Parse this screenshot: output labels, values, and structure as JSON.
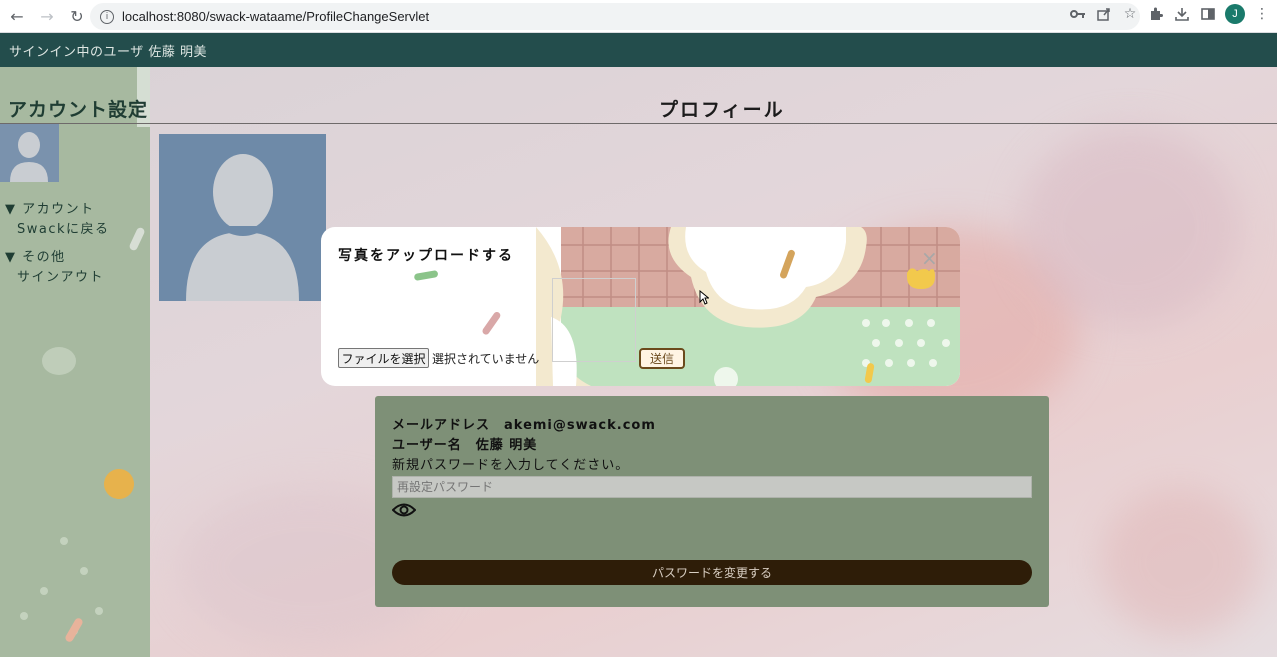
{
  "browser": {
    "url": "localhost:8080/swack-wataame/ProfileChangeServlet",
    "profile_initial": "J"
  },
  "header": {
    "signed_in_text": "サインイン中のユーザ 佐藤 明美"
  },
  "sidebar": {
    "title": "アカウント設定",
    "sections": [
      {
        "heading": "▼ アカウント",
        "items": [
          "Swackに戻る"
        ]
      },
      {
        "heading": "▼ その他",
        "items": [
          "サインアウト"
        ]
      }
    ]
  },
  "main": {
    "title": "プロフィール"
  },
  "profile_card": {
    "email_line": "メールアドレス　akemi@swack.com",
    "username_line": "ユーザー名　佐藤 明美",
    "password_prompt": "新規パスワードを入力してください。",
    "password_placeholder": "再設定パスワード",
    "change_button": "パスワードを変更する"
  },
  "upload_modal": {
    "title": "写真をアップロードする",
    "file_button": "ファイルを選択",
    "file_status": "選択されていません",
    "send_button": "送信",
    "close_symbol": "×"
  },
  "colors": {
    "header_bg": "#234d4c",
    "sidebar_bg": "#a7b9a0",
    "card_bg": "#7e9077",
    "change_button_bg": "#2e1d08",
    "avatar_bg": "#6e8aa8"
  }
}
